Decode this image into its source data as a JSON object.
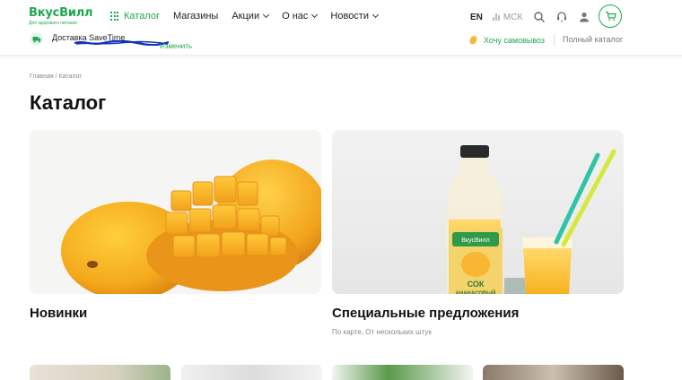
{
  "header": {
    "logo_title": "ВкусВилл",
    "logo_subtitle": "Для здорового питания",
    "nav": [
      {
        "label": "Каталог",
        "active": true
      },
      {
        "label": "Магазины"
      },
      {
        "label": "Акции",
        "dropdown": true
      },
      {
        "label": "О нас",
        "dropdown": true
      },
      {
        "label": "Новости",
        "dropdown": true
      }
    ],
    "lang": "EN",
    "city": "МСК",
    "icons": [
      "search-icon",
      "support-icon",
      "user-icon",
      "cart-icon"
    ],
    "delivery_label": "Доставка SaveTime",
    "change_label": "Изменить",
    "pickup_label": "Хочу самовывоз",
    "full_catalog_label": "Полный каталог",
    "accent_color": "#1fa84f"
  },
  "breadcrumb": "Главная / Каталог",
  "page_title": "Каталог",
  "categories": [
    {
      "title": "Новинки",
      "subtitle": ""
    },
    {
      "title": "Специальные предложения",
      "subtitle": "По карте, От нескольких штук"
    }
  ],
  "product_labels": {
    "juice_brand": "ВкусВилл",
    "juice_label": "СОК",
    "juice_type": "АНАНАСОВЫЙ"
  }
}
